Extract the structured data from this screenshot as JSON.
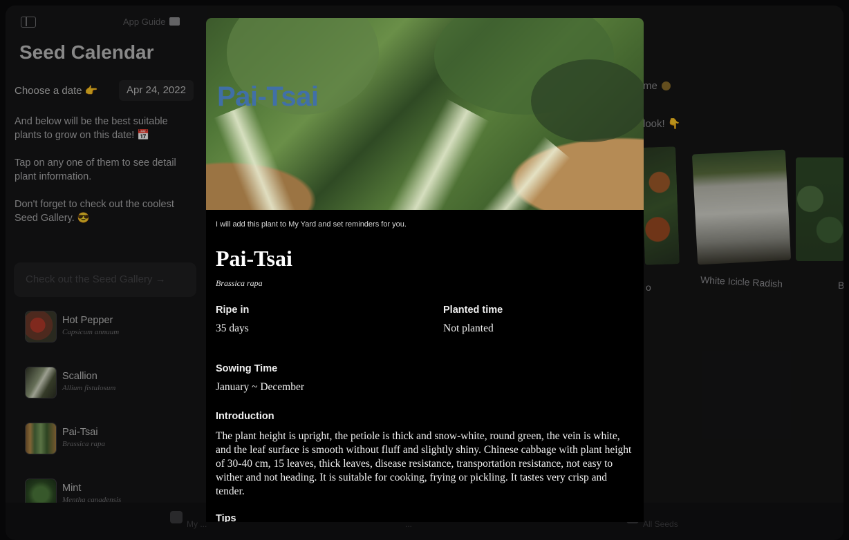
{
  "sidebar": {
    "app_guide_label": "App Guide",
    "title": "Seed Calendar",
    "date_label": "Choose a date 👉",
    "date_value": "Apr 24, 2022",
    "paragraphs": [
      "And below will be the best suitable plants to grow on this date! 📅",
      "Tap on any one of them to see detail plant information.",
      "Don't forget to check out the coolest Seed Gallery. 😎"
    ],
    "gallery_button": "Check out the Seed Gallery →",
    "plants": [
      {
        "name": "Hot Pepper",
        "scientific": "Capsicum annuum"
      },
      {
        "name": "Scallion",
        "scientific": "Allium fistulosum"
      },
      {
        "name": "Pai-Tsai",
        "scientific": "Brassica rapa"
      },
      {
        "name": "Mint",
        "scientific": "Mentha canadensis"
      }
    ]
  },
  "main": {
    "text_1": "me",
    "text_2": "look! 👇",
    "card_labels": [
      "White Icicle Radish",
      "o",
      "Ba"
    ]
  },
  "tabbar": {
    "labels": [
      "My ...",
      "...",
      "All Seeds"
    ]
  },
  "modal": {
    "hero_title": "Pai-Tsai",
    "note": "I will add this plant to My Yard and set reminders for you.",
    "title": "Pai-Tsai",
    "scientific": "Brassica rapa",
    "ripe_label": "Ripe in",
    "ripe_value": "35 days",
    "planted_label": "Planted time",
    "planted_value": "Not planted",
    "sowing_label": "Sowing Time",
    "sowing_value": "January ~ December",
    "intro_label": "Introduction",
    "intro_text": "The plant height is upright, the petiole is thick and snow-white, round green, the vein is white, and the leaf surface is smooth without fluff and slightly shiny. Chinese cabbage with plant height of 30-40 cm, 15 leaves, thick leaves, disease resistance, transportation resistance, not easy to wither and not heading. It is suitable for cooking, frying or pickling. It tastes very crisp and tender.",
    "tips_label": "Tips"
  }
}
